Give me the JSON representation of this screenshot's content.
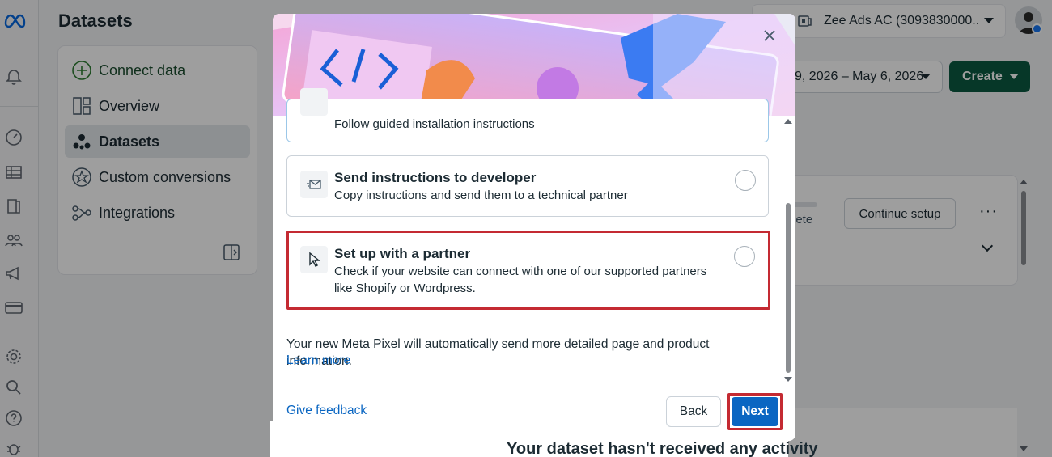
{
  "page": {
    "title": "Datasets"
  },
  "left_nav": {
    "items": [
      {
        "label": "Connect data",
        "icon": "plus-circle-icon"
      },
      {
        "label": "Overview",
        "icon": "overview-icon"
      },
      {
        "label": "Datasets",
        "icon": "datasets-icon",
        "active": true
      },
      {
        "label": "Custom conversions",
        "icon": "star-badge-icon"
      },
      {
        "label": "Integrations",
        "icon": "integrations-icon"
      }
    ]
  },
  "topbar": {
    "account": "Zee Ads AC (3093830000...",
    "date_range": "9, 2026 – May 6, 2026",
    "create_label": "Create"
  },
  "background_card": {
    "status_fragment": "lete",
    "continue_label": "Continue setup",
    "more_label": "···"
  },
  "background_heading": "Your dataset hasn't received any activity",
  "dialog": {
    "options": [
      {
        "title": "",
        "description": "Follow guided installation instructions",
        "icon": "guided-install-icon"
      },
      {
        "title": "Send instructions to developer",
        "description": "Copy instructions and send them to a technical partner",
        "icon": "send-envelope-icon"
      },
      {
        "title": "Set up with a partner",
        "description": "Check if your website can connect with one of our supported partners like Shopify or Wordpress.",
        "icon": "cursor-pointer-icon"
      }
    ],
    "note": "Your new Meta Pixel will automatically send more detailed page and product information.",
    "learn_more": "Learn more",
    "give_feedback": "Give feedback",
    "back_label": "Back",
    "next_label": "Next"
  },
  "colors": {
    "accent_blue": "#0a66c2",
    "create_green": "#0b5a42",
    "highlight_red": "#c42a32"
  }
}
